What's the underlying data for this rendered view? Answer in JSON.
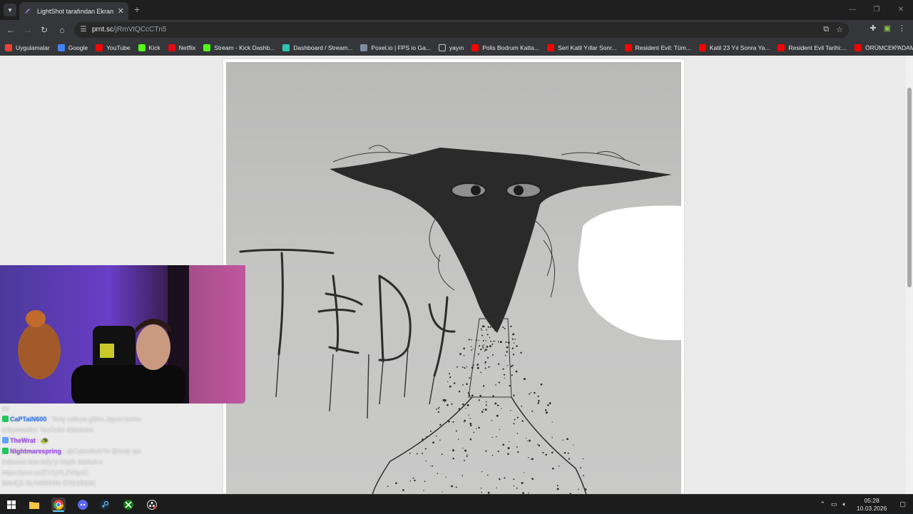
{
  "browser": {
    "tab": {
      "title": "LightShot tarafından Ekran Görü",
      "close": "✕"
    },
    "new_tab": "+",
    "window_controls": [
      "—",
      "❐",
      "✕"
    ],
    "url_host": "prnt.sc",
    "url_path": "/jRmVtQCcCTn5"
  },
  "bookmarks": [
    {
      "label": "Uygulamalar",
      "icon": "apps-grid-icon",
      "color": "#ea4335"
    },
    {
      "label": "Google",
      "icon": "google-icon",
      "color": "#4285f4"
    },
    {
      "label": "YouTube",
      "icon": "youtube-icon",
      "color": "#ff0000"
    },
    {
      "label": "Kick",
      "icon": "kick-icon",
      "color": "#53fc18"
    },
    {
      "label": "Netflix",
      "icon": "netflix-icon",
      "color": "#e50914"
    },
    {
      "label": "Stream - Kick Dashb...",
      "icon": "kick-icon",
      "color": "#53fc18"
    },
    {
      "label": "Dashboard / Stream...",
      "icon": "dashboard-icon",
      "color": "#2ec4b6"
    },
    {
      "label": "Poxel.io | FPS io Ga...",
      "icon": "poxel-icon",
      "color": "#7e8ca3"
    },
    {
      "label": "yayın",
      "icon": "folder-icon",
      "color": "#35363a"
    },
    {
      "label": "Polis Bodrum Katta...",
      "icon": "youtube-icon",
      "color": "#ff0000"
    },
    {
      "label": "Seri Katil Yıllar Sonr...",
      "icon": "youtube-icon",
      "color": "#ff0000"
    },
    {
      "label": "Resident Evil: Tüm...",
      "icon": "youtube-icon",
      "color": "#ff0000"
    },
    {
      "label": "Katil 23 Yıl Sonra Ya...",
      "icon": "youtube-icon",
      "color": "#ff0000"
    },
    {
      "label": "Resident Evil Tarihi:...",
      "icon": "youtube-icon",
      "color": "#ff0000"
    },
    {
      "label": "ÖRÜMCEK ADAM H...",
      "icon": "youtube-icon",
      "color": "#ff0000"
    }
  ],
  "bookmarks_more": "»",
  "drawing": {
    "handwritten_text": "TEDY"
  },
  "chat": [
    {
      "user": "",
      "message": "mi",
      "user_color": "#cfcfcf"
    },
    {
      "user": "CaPTaiN600",
      "message": ": Tedy sabura gittim Japon korku",
      "user_color": "#3b82f6",
      "badge_color": "#22c55e"
    },
    {
      "user": "",
      "message": "izleyemedim YouTube atacanım",
      "user_color": "#cfcfcf"
    },
    {
      "user": "TheWrat",
      "message": ": 🐢",
      "user_color": "#a855f7",
      "badge_color": "#60a5fa"
    },
    {
      "user": "Nightmarespring",
      "message": ": @CyberBulzTv @tedy abi",
      "user_color": "#a855f7",
      "badge_color": "#22c55e"
    },
    {
      "user": "",
      "message": "baksana ben tedy'yi böyle darladım",
      "user_color": "#cfcfcf"
    },
    {
      "user": "",
      "message": "https://prnt.sc/ZYZyVLZVkpzC",
      "user_color": "#cfcfcf"
    },
    {
      "user": "",
      "message": "BAHÇE DUVARININ ÖTESİNDE",
      "user_color": "#cfcfcf"
    }
  ],
  "taskbar": {
    "apps": [
      "start-icon",
      "file-explorer-icon",
      "chrome-icon",
      "discord-icon",
      "steam-icon",
      "xbox-icon",
      "obs-icon"
    ],
    "time": "05:28",
    "date": "10.03.2026"
  }
}
